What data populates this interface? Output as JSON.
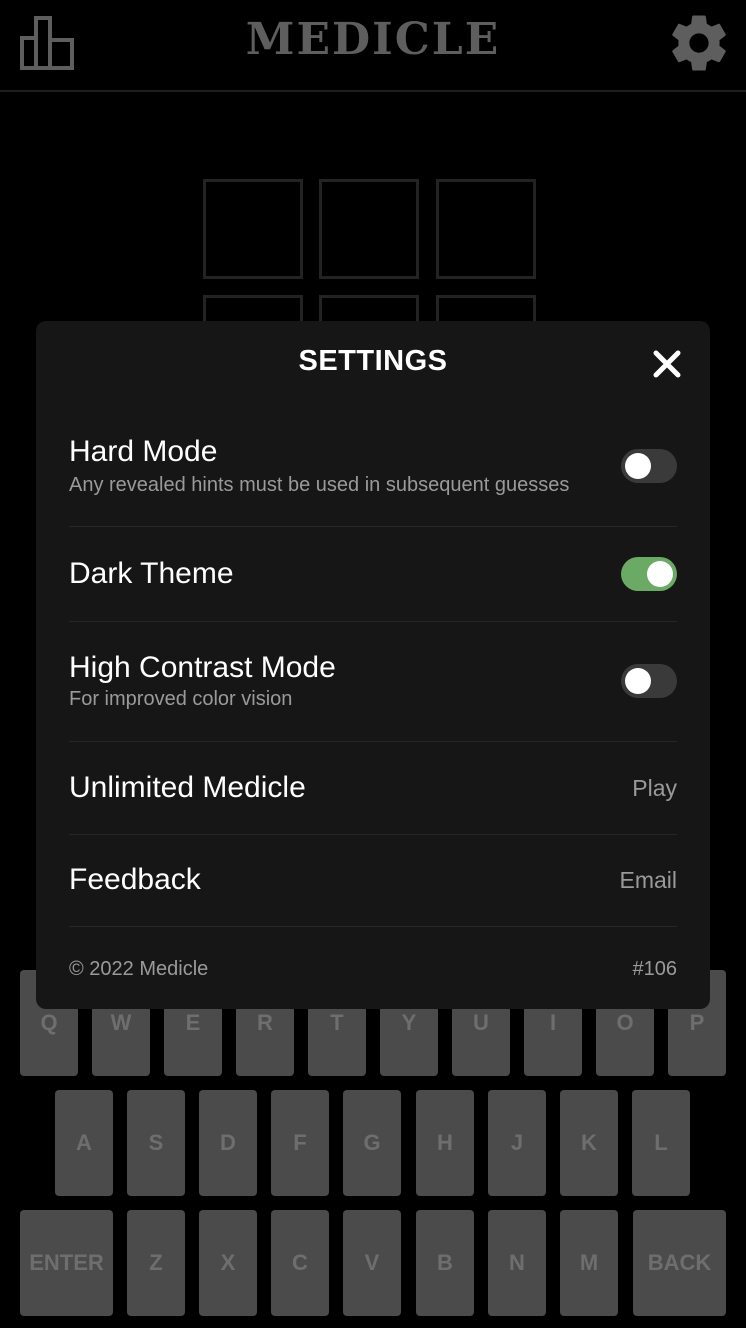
{
  "header": {
    "title": "MEDICLE",
    "stats_icon": "bar-chart-icon",
    "settings_icon": "gear-icon"
  },
  "settings": {
    "title": "SETTINGS",
    "close_icon": "close-icon",
    "hard_mode": {
      "label": "Hard Mode",
      "description": "Any revealed hints must be used in subsequent guesses",
      "enabled": false
    },
    "dark_theme": {
      "label": "Dark Theme",
      "enabled": true
    },
    "high_contrast": {
      "label": "High Contrast Mode",
      "description": "For improved color vision",
      "enabled": false
    },
    "unlimited": {
      "label": "Unlimited Medicle",
      "action": "Play"
    },
    "feedback": {
      "label": "Feedback",
      "action": "Email"
    },
    "footer": {
      "copyright": "© 2022 Medicle",
      "puzzle_number": "#106"
    }
  },
  "keyboard": {
    "row1": [
      "Q",
      "W",
      "E",
      "R",
      "T",
      "Y",
      "U",
      "I",
      "O",
      "P"
    ],
    "row2": [
      "A",
      "S",
      "D",
      "F",
      "G",
      "H",
      "J",
      "K",
      "L"
    ],
    "row3": [
      "ENTER",
      "Z",
      "X",
      "C",
      "V",
      "B",
      "N",
      "M",
      "BACK"
    ]
  },
  "colors": {
    "accent": "#6aaa64",
    "modal_bg": "#161616",
    "key_bg": "#4b4b4b",
    "title": "#5e5e5e"
  }
}
